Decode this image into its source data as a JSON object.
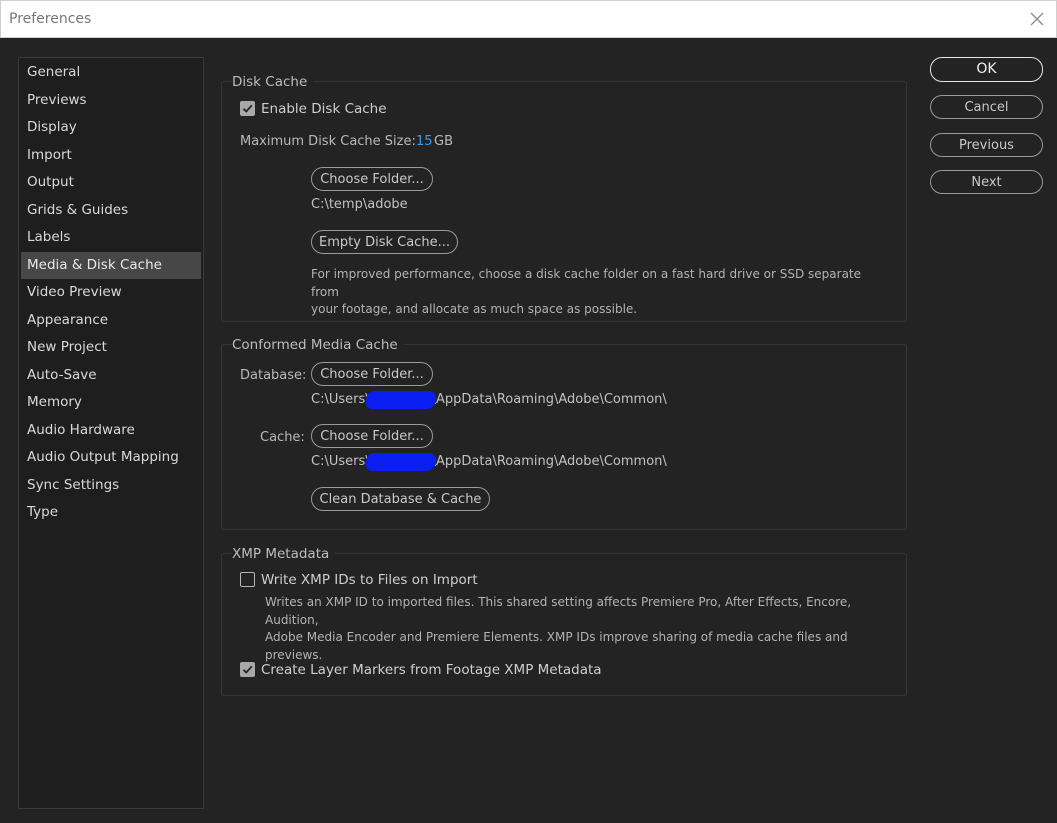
{
  "window": {
    "title": "Preferences"
  },
  "sidebar": {
    "items": [
      {
        "label": "General"
      },
      {
        "label": "Previews"
      },
      {
        "label": "Display"
      },
      {
        "label": "Import"
      },
      {
        "label": "Output"
      },
      {
        "label": "Grids & Guides"
      },
      {
        "label": "Labels"
      },
      {
        "label": "Media & Disk Cache"
      },
      {
        "label": "Video Preview"
      },
      {
        "label": "Appearance"
      },
      {
        "label": "New Project"
      },
      {
        "label": "Auto-Save"
      },
      {
        "label": "Memory"
      },
      {
        "label": "Audio Hardware"
      },
      {
        "label": "Audio Output Mapping"
      },
      {
        "label": "Sync Settings"
      },
      {
        "label": "Type"
      }
    ],
    "selected": "Media & Disk Cache"
  },
  "disk_cache": {
    "title": "Disk Cache",
    "enable_label": "Enable Disk Cache",
    "enable_checked": true,
    "max_size_label": "Maximum Disk Cache Size:",
    "max_size_value": "15",
    "max_size_unit": "GB",
    "choose_folder": "Choose Folder...",
    "folder_path": "C:\\temp\\adobe",
    "empty_button": "Empty Disk Cache...",
    "help_line1": "For improved performance, choose a disk cache folder on a fast hard drive or SSD separate from",
    "help_line2": "your footage, and allocate as much space as possible."
  },
  "conformed": {
    "title": "Conformed Media Cache",
    "database_label": "Database:",
    "database_button": "Choose Folder...",
    "database_path_prefix": "C:\\Users\\",
    "database_path_suffix": "\\AppData\\Roaming\\Adobe\\Common\\",
    "cache_label": "Cache:",
    "cache_button": "Choose Folder...",
    "cache_path_prefix": "C:\\Users\\",
    "cache_path_suffix": "\\AppData\\Roaming\\Adobe\\Common\\",
    "clean_button": "Clean Database & Cache",
    "redaction_color": "#0b1ef2"
  },
  "xmp": {
    "title": "XMP Metadata",
    "write_label": "Write XMP IDs to Files on Import",
    "write_checked": false,
    "write_help_line1": "Writes an XMP ID to imported files. This shared setting affects Premiere Pro, After Effects, Encore, Audition,",
    "write_help_line2": "Adobe Media Encoder and Premiere Elements. XMP IDs improve sharing of media cache files and previews.",
    "markers_label": "Create Layer Markers from Footage XMP Metadata",
    "markers_checked": true
  },
  "actions": {
    "ok": "OK",
    "cancel": "Cancel",
    "previous": "Previous",
    "next": "Next"
  },
  "colors": {
    "background": "#232323",
    "accent_value": "#3d9be9",
    "selected_item": "#474747"
  }
}
